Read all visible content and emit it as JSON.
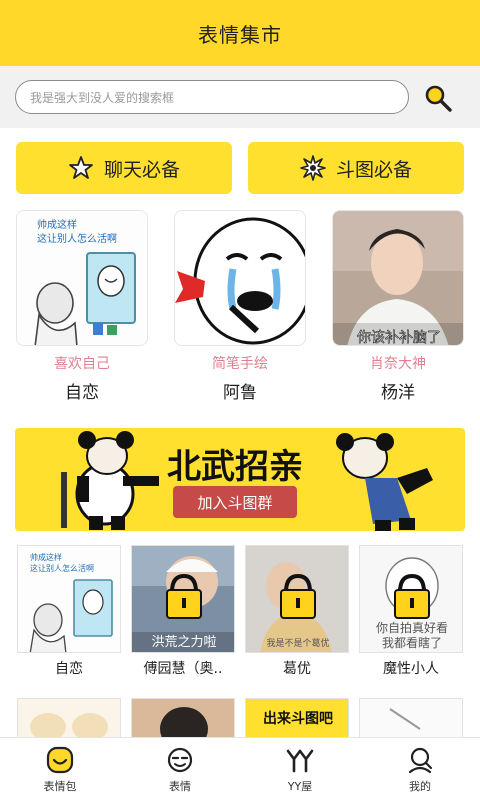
{
  "header": {
    "title": "表情集市"
  },
  "search": {
    "placeholder": "我是强大到没人爱的搜索框",
    "button_icon": "search-icon"
  },
  "categories": [
    {
      "label": "聊天必备",
      "icon": "star-icon"
    },
    {
      "label": "斗图必备",
      "icon": "burst-icon"
    }
  ],
  "featured": [
    {
      "tag": "喜欢自己",
      "name": "自恋",
      "caption": [
        "帅成这样",
        "这让别人怎么活啊"
      ]
    },
    {
      "tag": "简笔手绘",
      "name": "阿鲁"
    },
    {
      "tag": "肖奈大神",
      "name": "杨洋",
      "caption": [
        "你该补补脑了"
      ]
    }
  ],
  "banner": {
    "title": "北武招亲",
    "button": "加入斗图群"
  },
  "packs": [
    {
      "name": "自恋",
      "locked": false,
      "caption": [
        "帅成这样",
        "这让别人怎么活啊"
      ]
    },
    {
      "name": "傅园慧（奥..",
      "locked": true,
      "caption": [
        "洪荒之力啦"
      ]
    },
    {
      "name": "葛优",
      "locked": true,
      "caption": [
        "我是不是个葛优"
      ]
    },
    {
      "name": "魔性小人",
      "locked": true,
      "caption": [
        "你自拍真好看",
        "我都看瞎了"
      ]
    }
  ],
  "next_row": [
    {
      "caption": ""
    },
    {
      "caption": ""
    },
    {
      "caption": "出来斗图吧"
    },
    {
      "caption": ""
    }
  ],
  "tabs": [
    {
      "label": "表情包",
      "icon": "emoji-face-icon",
      "active": true
    },
    {
      "label": "表情",
      "icon": "face-icon",
      "active": false
    },
    {
      "label": "YY屋",
      "icon": "yy-icon",
      "active": false
    },
    {
      "label": "我的",
      "icon": "profile-icon",
      "active": false
    }
  ],
  "colors": {
    "brand_yellow": "#ffd82a",
    "accent_pink": "#e17f92",
    "lock_yellow": "#ffd21c"
  }
}
